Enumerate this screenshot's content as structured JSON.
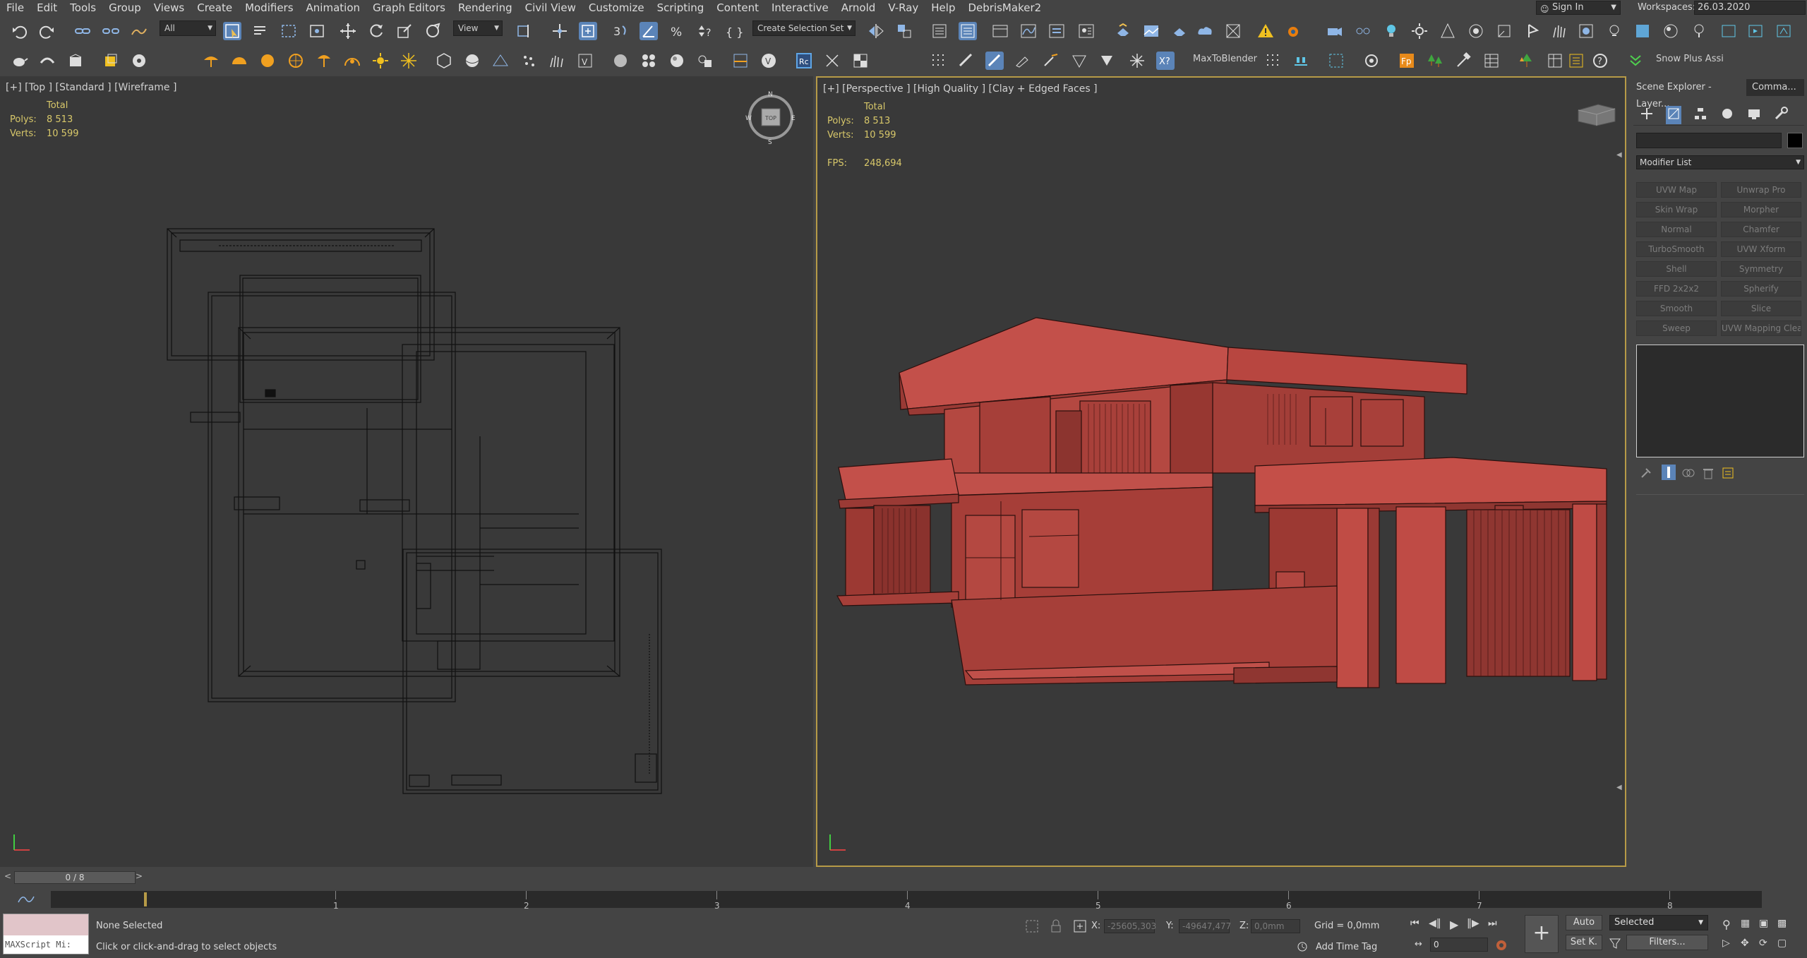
{
  "menu": [
    "File",
    "Edit",
    "Tools",
    "Group",
    "Views",
    "Create",
    "Modifiers",
    "Animation",
    "Graph Editors",
    "Rendering",
    "Civil View",
    "Customize",
    "Scripting",
    "Content",
    "Interactive",
    "Arnold",
    "V-Ray",
    "Help",
    "DebrisMaker2"
  ],
  "header": {
    "sign_in": "Sign In",
    "workspaces_label": "Workspaces:",
    "workspace_value": "26.03.2020"
  },
  "toolbar": {
    "filter_select": "All",
    "coord_select": "View",
    "selection_set": "Create Selection Set",
    "max_to_blender": "MaxToBlender",
    "snow_plus": "Snow Plus Assi"
  },
  "viewport_top": {
    "label": "[+] [Top ] [Standard ] [Wireframe ]",
    "stats_header": "Total",
    "polys_label": "Polys:",
    "polys": "8 513",
    "verts_label": "Verts:",
    "verts": "10 599",
    "viewcube_label": "TOP",
    "compass": {
      "n": "N",
      "s": "S",
      "e": "E",
      "w": "W"
    }
  },
  "viewport_persp": {
    "label": "[+] [Perspective ] [High Quality ] [Clay + Edged Faces ]",
    "stats_header": "Total",
    "polys_label": "Polys:",
    "polys": "8 513",
    "verts_label": "Verts:",
    "verts": "10 599",
    "fps_label": "FPS:",
    "fps": "248,694",
    "clay_color": "#b9473d"
  },
  "command_panel": {
    "tab_scene_explorer": "Scene Explorer - Layer...",
    "tab_command": "Comma...",
    "modifier_list": "Modifier List",
    "modifiers": [
      [
        "UVW Map",
        "Unwrap Pro"
      ],
      [
        "Skin Wrap",
        "Morpher"
      ],
      [
        "Normal",
        "Chamfer"
      ],
      [
        "TurboSmooth",
        "UVW Xform"
      ],
      [
        "Shell",
        "Symmetry"
      ],
      [
        "FFD 2x2x2",
        "Spherify"
      ],
      [
        "Smooth",
        "Slice"
      ],
      [
        "Sweep",
        "UVW Mapping Clear"
      ]
    ]
  },
  "timeline": {
    "frame_counter": "0 / 8",
    "prev": "<",
    "next": ">",
    "ticks": [
      "1",
      "2",
      "3",
      "4",
      "5",
      "6",
      "7",
      "8"
    ]
  },
  "status": {
    "maxscript_label": "MAXScript Mi:",
    "selection": "None Selected",
    "prompt": "Click or click-and-drag to select objects",
    "x_label": "X:",
    "x_value": "-25605,303",
    "y_label": "Y:",
    "y_value": "-49647,477",
    "z_label": "Z:",
    "z_value": "0,0mm",
    "grid": "Grid = 0,0mm",
    "add_time_tag": "Add Time Tag",
    "auto_key": "Auto",
    "set_key": "Set K.",
    "key_mode": "Selected",
    "frame_value": "0",
    "filters": "Filters..."
  }
}
